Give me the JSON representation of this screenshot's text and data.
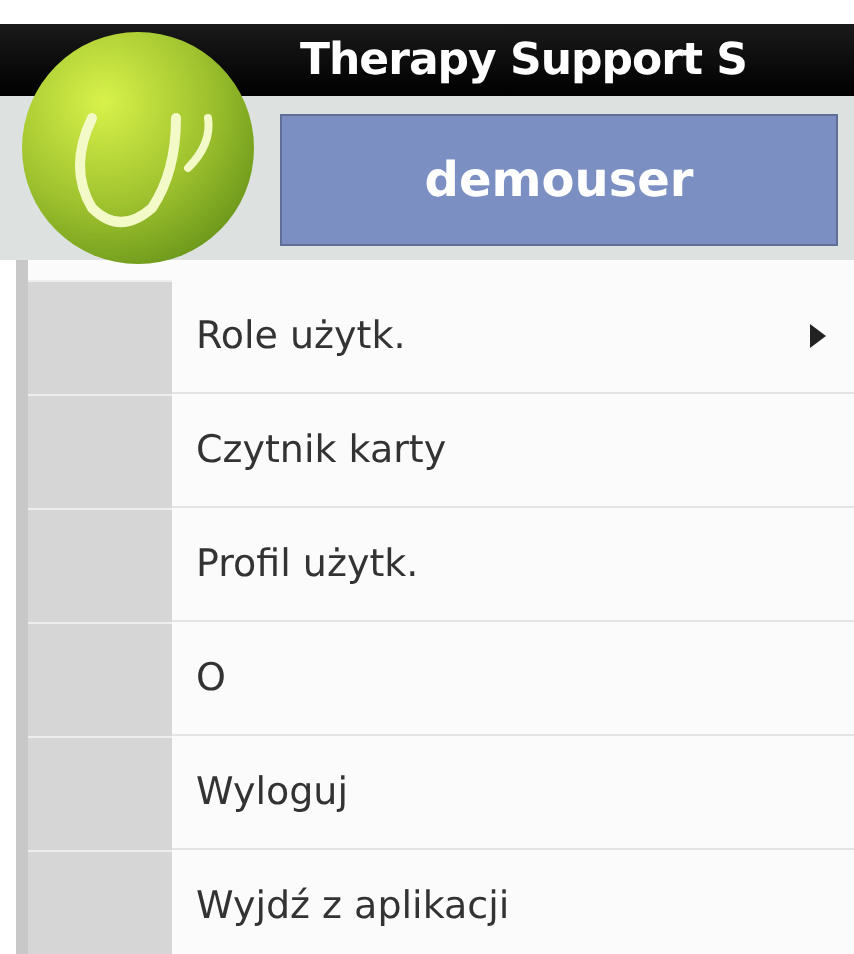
{
  "header": {
    "title": "Therapy Support S",
    "user_button": "demouser"
  },
  "menu": {
    "items": [
      {
        "label": "Role użytk.",
        "kind": "submenu"
      },
      {
        "label": "Czytnik karty",
        "kind": "action"
      },
      {
        "label": "Profil użytk.",
        "kind": "action"
      },
      {
        "label": "O",
        "kind": "action"
      },
      {
        "label": "Wyloguj",
        "kind": "action"
      },
      {
        "label": "Wyjdź z aplikacji",
        "kind": "action"
      }
    ]
  }
}
